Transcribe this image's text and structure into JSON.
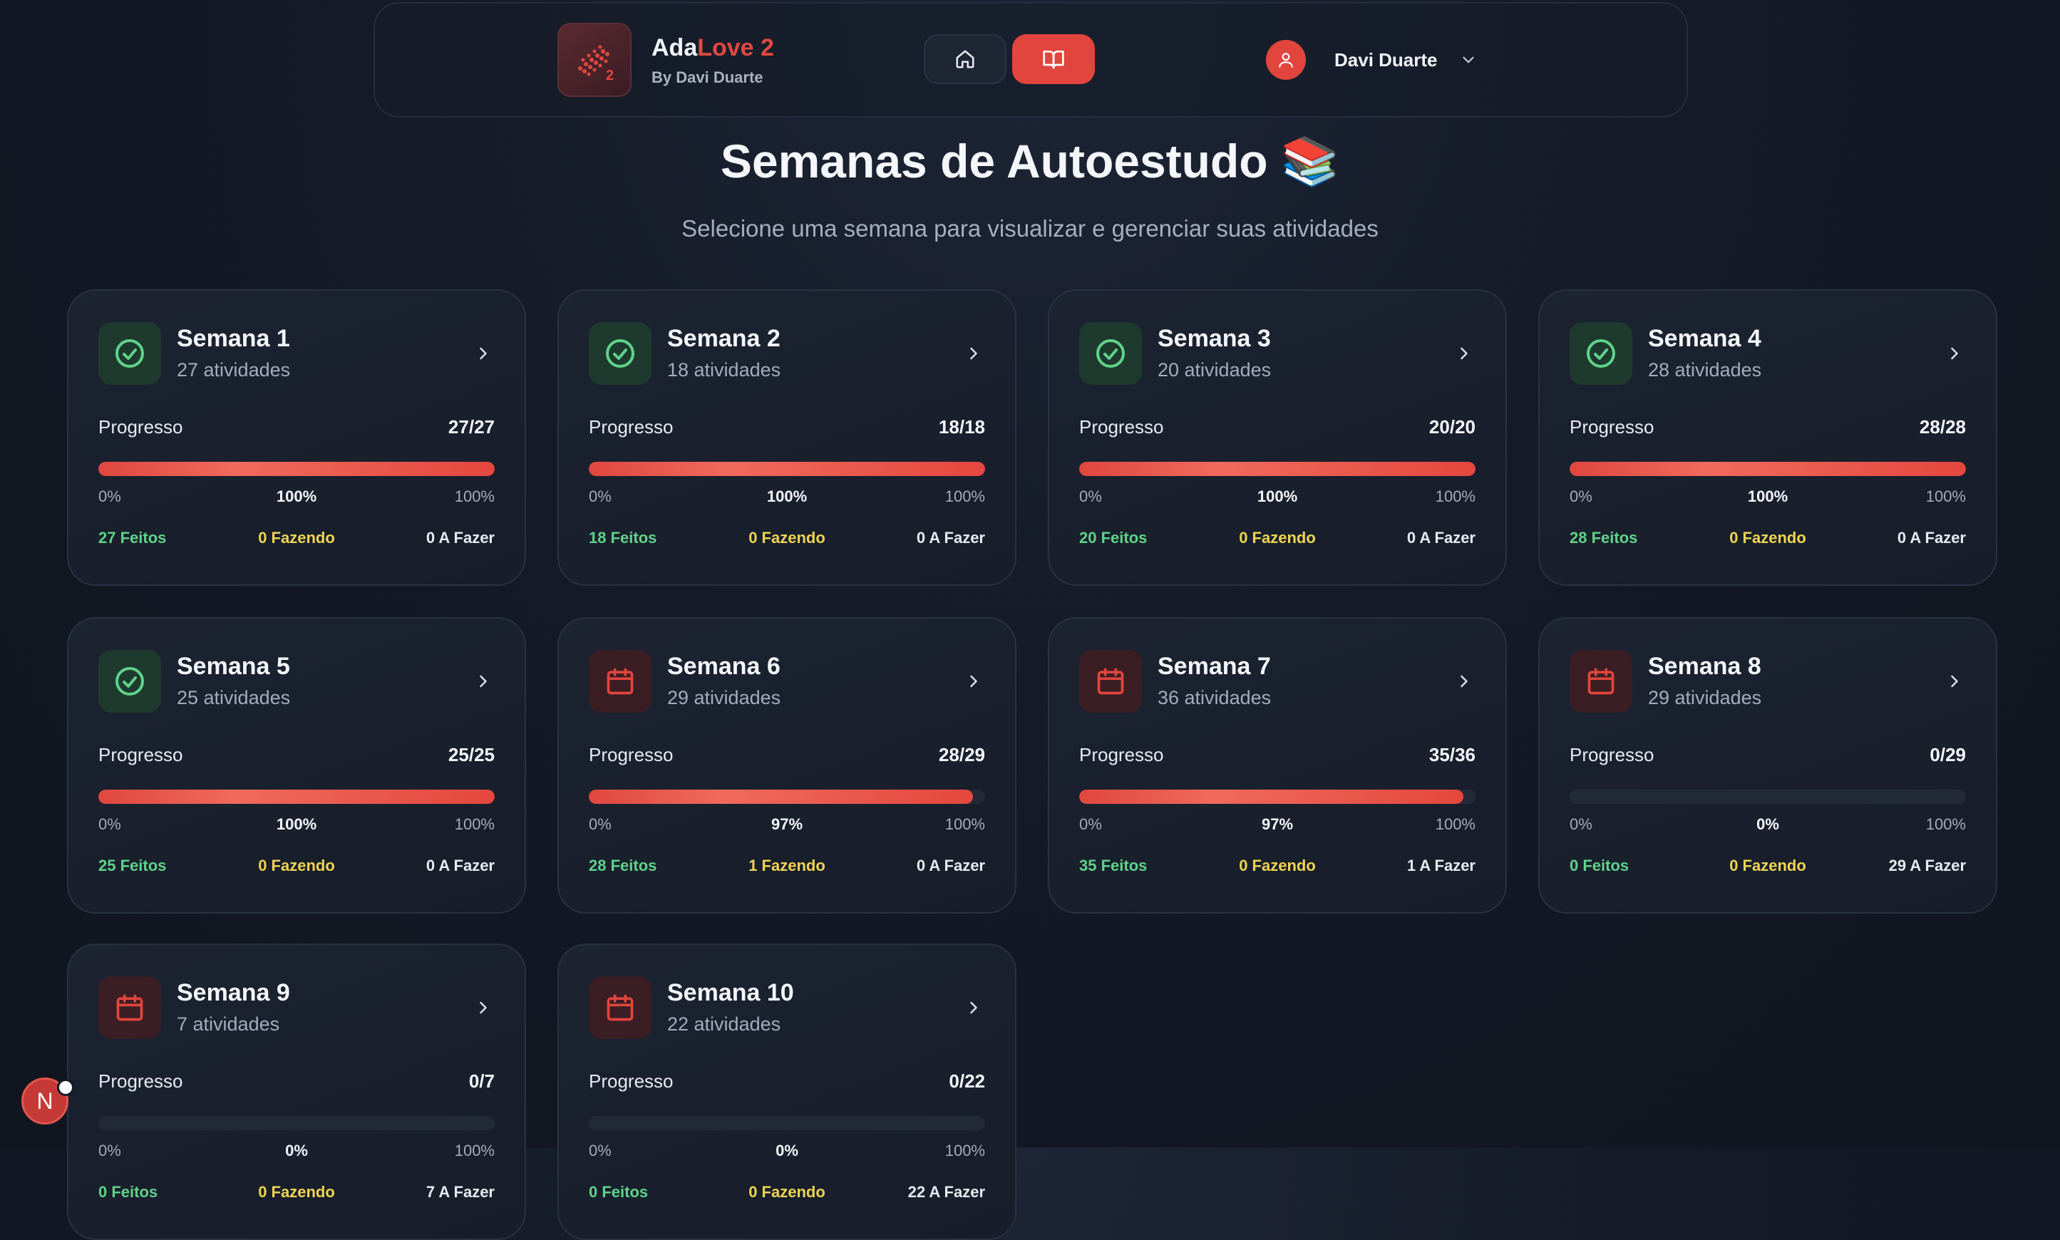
{
  "header": {
    "brand_main": "Ada",
    "brand_accent": "Love 2",
    "brand_sub": "By Davi Duarte",
    "nav": [
      {
        "icon": "home-icon"
      },
      {
        "icon": "book-open-icon",
        "active": true
      }
    ],
    "user": {
      "name": "Davi Duarte",
      "avatar_icon": "user-icon",
      "menu_icon": "chevron-down-icon"
    }
  },
  "page": {
    "title": "Semanas de Autoestudo 📚",
    "subtitle": "Selecione uma semana para visualizar e gerenciar suas atividades"
  },
  "labels": {
    "progress": "Progresso",
    "min": "0%",
    "max": "100%"
  },
  "weeks": [
    {
      "name": "Semana 1",
      "count": "27 atividades",
      "progress": "27/27",
      "percent": "100%",
      "fill": 1.0,
      "done": "27 Feitos",
      "doing": "0 Fazendo",
      "todo": "0 A Fazer",
      "status": "complete"
    },
    {
      "name": "Semana 2",
      "count": "18 atividades",
      "progress": "18/18",
      "percent": "100%",
      "fill": 1.0,
      "done": "18 Feitos",
      "doing": "0 Fazendo",
      "todo": "0 A Fazer",
      "status": "complete"
    },
    {
      "name": "Semana 3",
      "count": "20 atividades",
      "progress": "20/20",
      "percent": "100%",
      "fill": 1.0,
      "done": "20 Feitos",
      "doing": "0 Fazendo",
      "todo": "0 A Fazer",
      "status": "complete"
    },
    {
      "name": "Semana 4",
      "count": "28 atividades",
      "progress": "28/28",
      "percent": "100%",
      "fill": 1.0,
      "done": "28 Feitos",
      "doing": "0 Fazendo",
      "todo": "0 A Fazer",
      "status": "complete"
    },
    {
      "name": "Semana 5",
      "count": "25 atividades",
      "progress": "25/25",
      "percent": "100%",
      "fill": 1.0,
      "done": "25 Feitos",
      "doing": "0 Fazendo",
      "todo": "0 A Fazer",
      "status": "complete"
    },
    {
      "name": "Semana 6",
      "count": "29 atividades",
      "progress": "28/29",
      "percent": "97%",
      "fill": 0.97,
      "done": "28 Feitos",
      "doing": "1 Fazendo",
      "todo": "0 A Fazer",
      "status": "pending"
    },
    {
      "name": "Semana 7",
      "count": "36 atividades",
      "progress": "35/36",
      "percent": "97%",
      "fill": 0.97,
      "done": "35 Feitos",
      "doing": "0 Fazendo",
      "todo": "1 A Fazer",
      "status": "pending"
    },
    {
      "name": "Semana 8",
      "count": "29 atividades",
      "progress": "0/29",
      "percent": "0%",
      "fill": 0,
      "done": "0 Feitos",
      "doing": "0 Fazendo",
      "todo": "29 A Fazer",
      "status": "pending"
    },
    {
      "name": "Semana 9",
      "count": "7 atividades",
      "progress": "0/7",
      "percent": "0%",
      "fill": 0,
      "done": "0 Feitos",
      "doing": "0 Fazendo",
      "todo": "7 A Fazer",
      "status": "pending"
    },
    {
      "name": "Semana 10",
      "count": "22 atividades",
      "progress": "0/22",
      "percent": "0%",
      "fill": 0,
      "done": "0 Feitos",
      "doing": "0 Fazendo",
      "todo": "22 A Fazer",
      "status": "pending"
    }
  ],
  "floating_badge": {
    "letter": "N"
  },
  "colors": {
    "accent": "#e2453d",
    "done": "#5fd38a",
    "doing": "#efd452"
  }
}
